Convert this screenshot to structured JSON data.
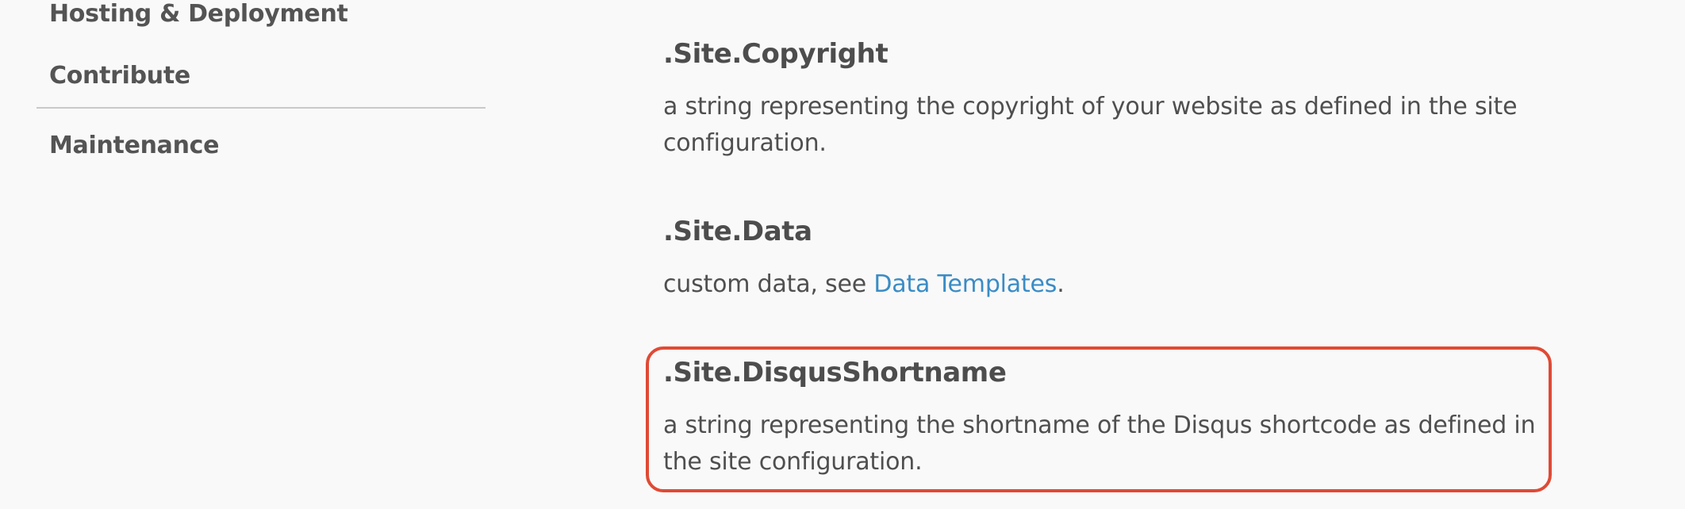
{
  "sidebar": {
    "items": [
      {
        "label": "Hosting & Deployment"
      },
      {
        "label": "Contribute"
      },
      {
        "label": "Maintenance"
      }
    ]
  },
  "main": {
    "entries": [
      {
        "title": ".Site.Copyright",
        "description": "a string representing the copyright of your website as defined in the site configuration."
      },
      {
        "title": ".Site.Data",
        "description_prefix": "custom data, see ",
        "link_text": "Data Templates",
        "description_suffix": "."
      },
      {
        "title": ".Site.DisqusShortname",
        "description": "a string representing the shortname of the Disqus shortcode as defined in the site configuration."
      }
    ]
  },
  "colors": {
    "link": "#3a8cc5",
    "highlight_border": "#e04a34",
    "background": "#f9f9f9"
  }
}
